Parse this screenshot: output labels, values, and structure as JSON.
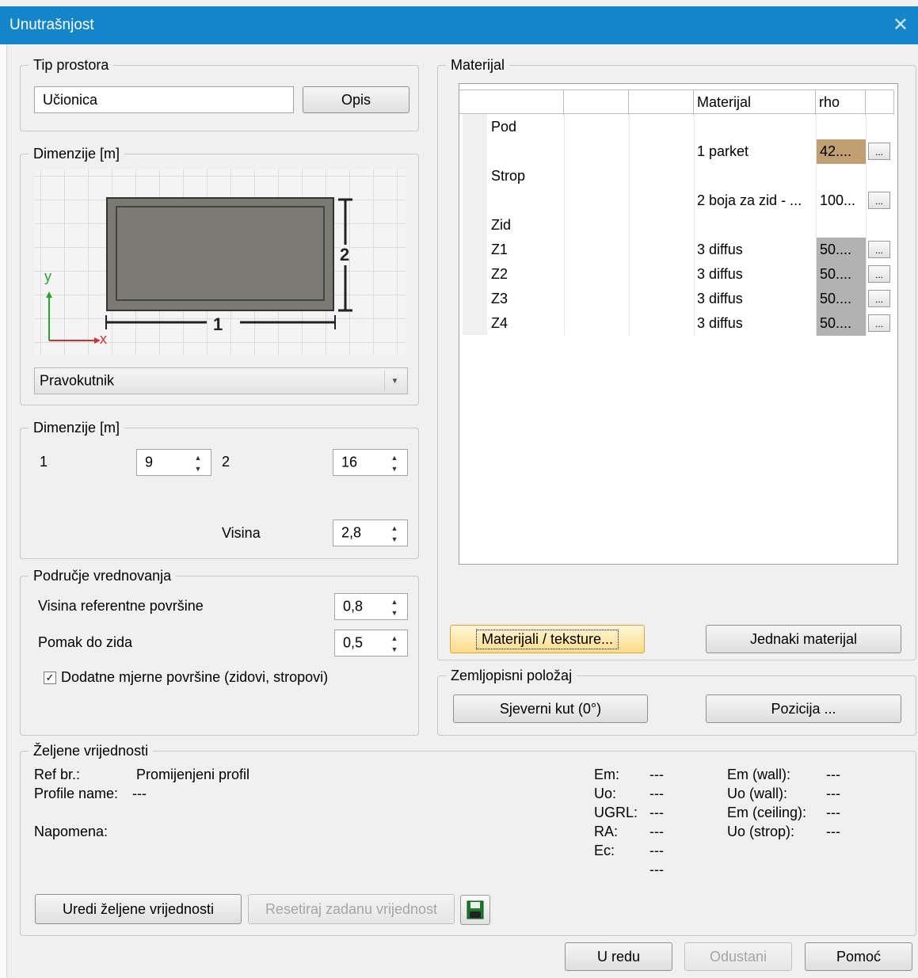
{
  "window": {
    "title": "Unutrašnjost"
  },
  "tip_prostora": {
    "label": "Tip prostora",
    "value": "Učionica",
    "opis_button": "Opis"
  },
  "dimenzije_preview": {
    "label": "Dimenzije [m]",
    "label_1": "1",
    "label_2": "2",
    "axis_y": "y",
    "axis_x": "x",
    "shape": "Pravokutnik"
  },
  "dimenzije": {
    "label": "Dimenzije [m]",
    "d1_label": "1",
    "d1_value": "9",
    "d2_label": "2",
    "d2_value": "16",
    "visina_label": "Visina",
    "visina_value": "2,8"
  },
  "podrucje": {
    "label": "Područje vrednovanja",
    "ref_label": "Visina referentne površine",
    "ref_value": "0,8",
    "pomak_label": "Pomak do zida",
    "pomak_value": "0,5",
    "checkbox_label": "Dodatne mjerne površine (zidovi, stropovi)",
    "checkbox_checked": true
  },
  "material": {
    "label": "Materijal",
    "headers": [
      "",
      "",
      "Materijal",
      "rho"
    ],
    "rows": [
      {
        "c1": "Pod",
        "mat": "",
        "rho": "",
        "btn": false,
        "color": ""
      },
      {
        "c1": "",
        "mat": "1 parket",
        "rho": "42....",
        "btn": true,
        "color": "#bf9f73"
      },
      {
        "c1": "Strop",
        "mat": "",
        "rho": "",
        "btn": false,
        "color": ""
      },
      {
        "c1": "",
        "mat": "2 boja za zid - ...",
        "rho": "100...",
        "btn": true,
        "color": "#ffffff"
      },
      {
        "c1": "Zid",
        "mat": "",
        "rho": "",
        "btn": false,
        "color": ""
      },
      {
        "c1": "Z1",
        "mat": "3 diffus",
        "rho": "50....",
        "btn": true,
        "color": "#b2b2b2"
      },
      {
        "c1": "Z2",
        "mat": "3 diffus",
        "rho": "50....",
        "btn": true,
        "color": "#b2b2b2"
      },
      {
        "c1": "Z3",
        "mat": "3 diffus",
        "rho": "50....",
        "btn": true,
        "color": "#b2b2b2"
      },
      {
        "c1": "Z4",
        "mat": "3 diffus",
        "rho": "50....",
        "btn": true,
        "color": "#b2b2b2"
      }
    ],
    "btn_glyph": "...",
    "materijali_button": "Materijali / teksture...",
    "jednaki_button": "Jednaki materijal"
  },
  "zemljopisni": {
    "label": "Zemljopisni položaj",
    "sjeverni_button": "Sjeverni kut (0°)",
    "pozicija_button": "Pozicija ..."
  },
  "zeljene": {
    "label": "Željene vrijednosti",
    "ref_label": "Ref br.:",
    "ref_value": "Promijenjeni profil",
    "profile_label": "Profile name:",
    "profile_value": "---",
    "napomena_label": "Napomena:",
    "stats_labels": [
      "Em:",
      "Uo:",
      "UGRL:",
      "RA:",
      "Ec:"
    ],
    "stats_values": [
      "---",
      "---",
      "---",
      "---",
      "---",
      "---"
    ],
    "wall_labels": [
      "Em (wall):",
      "Uo (wall):",
      "Em (ceiling):",
      "Uo (strop):"
    ],
    "wall_values": [
      "---",
      "---",
      "---",
      "---"
    ],
    "uredi_button": "Uredi željene vrijednosti",
    "resetiraj_button": "Resetiraj zadanu vrijednost"
  },
  "footer": {
    "ok_button": "U redu",
    "cancel_button": "Odustani",
    "help_button": "Pomoć"
  },
  "icons": {
    "spin_up": "▲",
    "spin_down": "▼",
    "dropdown": "▼",
    "check": "✓",
    "close": "✕"
  }
}
